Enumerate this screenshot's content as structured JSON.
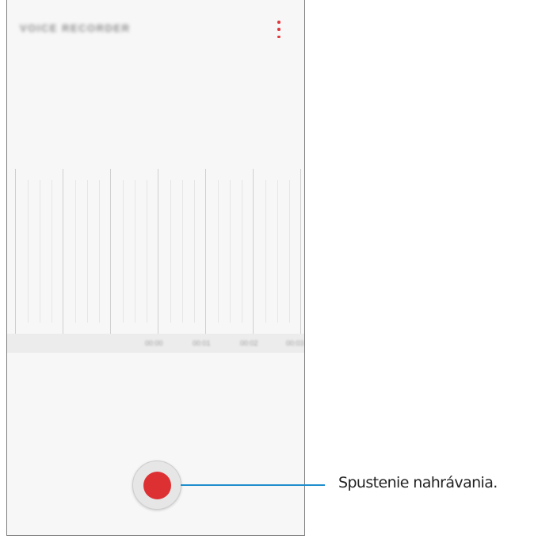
{
  "app": {
    "title": "VOICE RECORDER",
    "more_icon": "more-vert-icon",
    "accent_color": "#dd3033"
  },
  "timeline": {
    "labels": [
      "00:00",
      "00:01",
      "00:02",
      "00:03"
    ]
  },
  "record": {
    "icon": "record-icon"
  },
  "callout": {
    "text": "Spustenie nahrávania.",
    "line_color": "#1f8ecd"
  }
}
